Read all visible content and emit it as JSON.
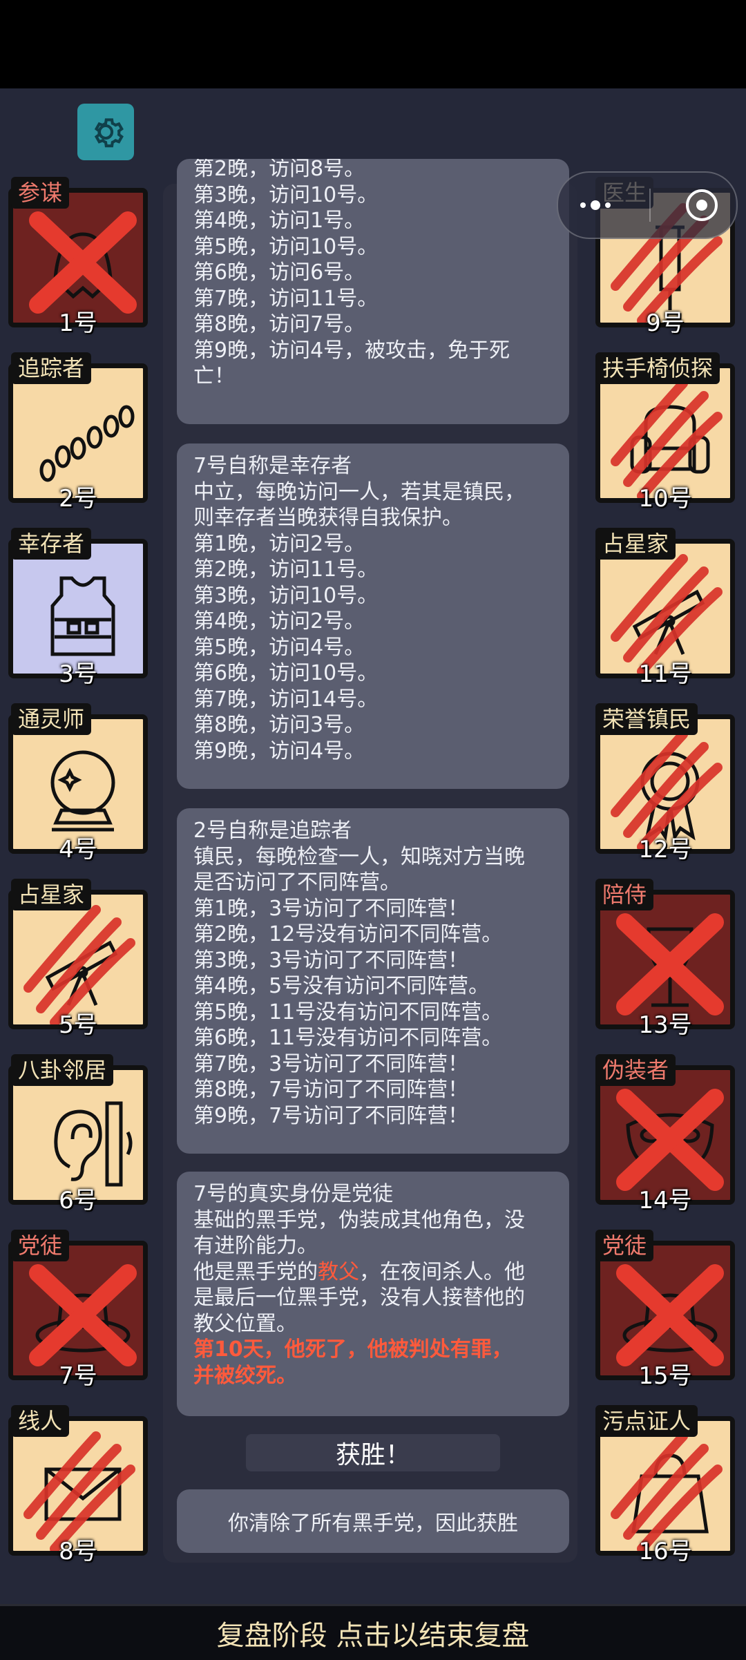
{
  "header": {
    "settings_icon": "gear-icon",
    "capsule_icons": [
      "more-dots-icon",
      "close-target-icon"
    ]
  },
  "players": [
    {
      "num": "1号",
      "role": "参谋",
      "status": "dead-mafia",
      "icon": "ghost-icon"
    },
    {
      "num": "2号",
      "role": "追踪者",
      "status": "alive",
      "icon": "footprints-icon"
    },
    {
      "num": "3号",
      "role": "幸存者",
      "status": "alive-self",
      "icon": "bulletproof-vest-icon"
    },
    {
      "num": "4号",
      "role": "通灵师",
      "status": "alive",
      "icon": "crystal-ball-icon"
    },
    {
      "num": "5号",
      "role": "占星家",
      "status": "dead-town",
      "icon": "telescope-icon"
    },
    {
      "num": "6号",
      "role": "八卦邻居",
      "status": "alive",
      "icon": "ear-wall-icon"
    },
    {
      "num": "7号",
      "role": "党徒",
      "status": "dead-mafia",
      "icon": "hat-icon"
    },
    {
      "num": "8号",
      "role": "线人",
      "status": "dead-town",
      "icon": "envelope-icon"
    },
    {
      "num": "9号",
      "role": "医生",
      "status": "dead-town",
      "icon": "syringe-icon"
    },
    {
      "num": "10号",
      "role": "扶手椅侦探",
      "status": "dead-town",
      "icon": "armchair-icon"
    },
    {
      "num": "11号",
      "role": "占星家",
      "status": "dead-town",
      "icon": "telescope-icon"
    },
    {
      "num": "12号",
      "role": "荣誉镇民",
      "status": "dead-town",
      "icon": "medal-icon"
    },
    {
      "num": "13号",
      "role": "陪侍",
      "status": "dead-mafia",
      "icon": "wine-glass-icon"
    },
    {
      "num": "14号",
      "role": "伪装者",
      "status": "dead-mafia",
      "icon": "mask-icon"
    },
    {
      "num": "15号",
      "role": "党徒",
      "status": "dead-mafia",
      "icon": "hat-icon"
    },
    {
      "num": "16号",
      "role": "污点证人",
      "status": "dead-town",
      "icon": "bag-icon"
    }
  ],
  "log": {
    "b1": [
      "第2晚，访问8号。",
      "第3晚，访问10号。",
      "第4晚，访问1号。",
      "第5晚，访问10号。",
      "第6晚，访问6号。",
      "第7晚，访问11号。",
      "第8晚，访问7号。",
      "第9晚，访问4号，被攻击，免于死",
      "亡！"
    ],
    "b2": [
      "7号自称是幸存者",
      "中立，每晚访问一人，若其是镇民，",
      "则幸存者当晚获得自我保护。",
      "第1晚，访问2号。",
      "第2晚，访问11号。",
      "第3晚，访问10号。",
      "第4晚，访问2号。",
      "第5晚，访问4号。",
      "第6晚，访问10号。",
      "第7晚，访问14号。",
      "第8晚，访问3号。",
      "第9晚，访问4号。"
    ],
    "b3": [
      "2号自称是追踪者",
      "镇民，每晚检查一人，知晓对方当晚",
      "是否访问了不同阵营。",
      "第1晚，3号访问了不同阵营！",
      "第2晚，12号没有访问不同阵营。",
      "第3晚，3号访问了不同阵营！",
      "第4晚，5号没有访问不同阵营。",
      "第5晚，11号没有访问不同阵营。",
      "第6晚，11号没有访问不同阵营。",
      "第7晚，3号访问了不同阵营！",
      "第8晚，7号访问了不同阵营！",
      "第9晚，7号访问了不同阵营！"
    ],
    "b4": {
      "l1": "7号的真实身份是党徒",
      "l2": "基础的黑手党，伪装成其他角色，没",
      "l3": "有进阶能力。",
      "l4a": "他是黑手党的",
      "l4b": "教父",
      "l4c": "，在夜间杀人。他",
      "l5": "是最后一位黑手党，没有人接替他的",
      "l6": "教父位置。",
      "l7": "第10天，他死了，他被判处有罪，",
      "l8": "并被绞死。"
    }
  },
  "victory": {
    "label": "获胜！",
    "message": "你清除了所有黑手党，因此获胜"
  },
  "bottom_bar": "复盘阶段 点击以结束复盘",
  "colors": {
    "town": "#f7d9a6",
    "mafia": "#6e2220",
    "self": "#c7c8ee",
    "highlight": "#ff5a3c",
    "accent": "#2f97a3"
  }
}
